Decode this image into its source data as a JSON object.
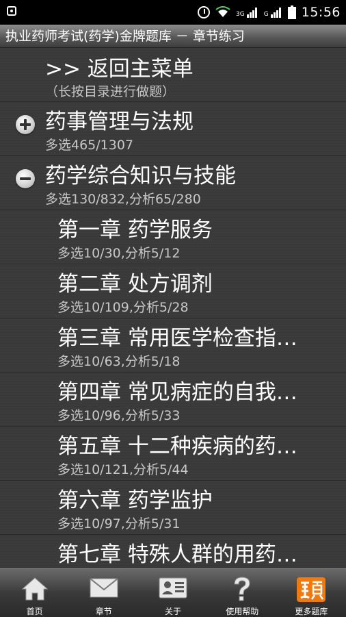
{
  "status_bar": {
    "net1": "3G",
    "net2": "G",
    "time": "15:56",
    "icons": [
      "screenshot-icon",
      "alarm-icon",
      "wifi-icon",
      "signal-icon",
      "signal-icon",
      "battery-icon"
    ]
  },
  "title": "执业药师考试(药学)金牌题库 － 章节练习",
  "list": {
    "back": {
      "title": ">> 返回主菜单",
      "hint": "（长按目录进行做题）"
    },
    "items": [
      {
        "title": "药事管理与法规",
        "sub": "多选465/1307",
        "toggle": "expand"
      },
      {
        "title": "药学综合知识与技能",
        "sub": "多选130/832,分析65/280",
        "toggle": "collapse"
      },
      {
        "title": "第一章 药学服务",
        "sub": "多选10/30,分析5/12"
      },
      {
        "title": "第二章 处方调剂",
        "sub": "多选10/109,分析5/28"
      },
      {
        "title": "第三章 常用医学检查指…",
        "sub": "多选10/63,分析5/18"
      },
      {
        "title": "第四章 常见病症的自我…",
        "sub": "多选10/96,分析5/33"
      },
      {
        "title": "第五章 十二种疾病的药…",
        "sub": "多选10/121,分析5/44"
      },
      {
        "title": "第六章 药学监护",
        "sub": "多选10/97,分析5/31"
      },
      {
        "title": "第七章 特殊人群的用药…",
        "sub": ""
      }
    ]
  },
  "bottom_nav": [
    {
      "label": "首页",
      "icon": "home-icon"
    },
    {
      "label": "章节",
      "icon": "mail-icon"
    },
    {
      "label": "关于",
      "icon": "id-card-icon"
    },
    {
      "label": "使用帮助",
      "icon": "question-icon"
    },
    {
      "label": "更多题库",
      "icon": "ti-logo-icon"
    }
  ],
  "colors": {
    "accent_orange": "#f07a10",
    "background": "#3b3b3b"
  }
}
